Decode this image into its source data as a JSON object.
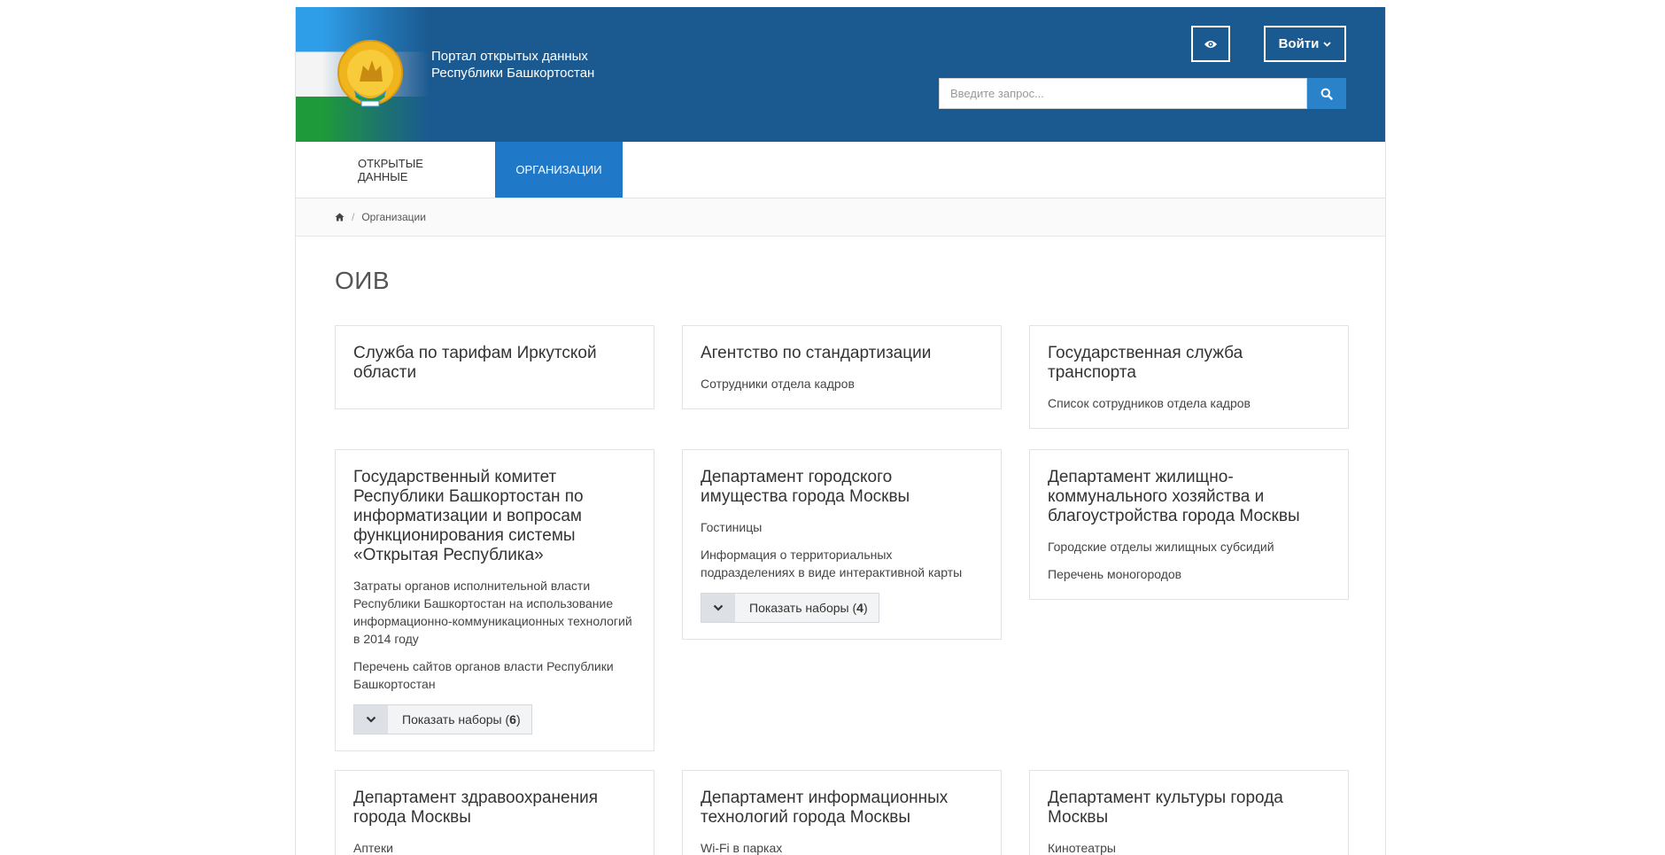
{
  "header": {
    "title_line1": "Портал открытых данных",
    "title_line2": "Республики Башкортостан",
    "login_label": "Войти",
    "search_placeholder": "Введите запрос..."
  },
  "nav": {
    "items": [
      {
        "label": "Открытые данные"
      },
      {
        "label": "Организации"
      }
    ]
  },
  "breadcrumb": {
    "current": "Организации"
  },
  "page": {
    "title": "ОИВ"
  },
  "cards": [
    {
      "title": "Служба по тарифам Иркутской области",
      "links": []
    },
    {
      "title": "Агентство по стандартизации",
      "links": [
        "Сотрудники отдела кадров"
      ]
    },
    {
      "title": "Государственная служба транспорта",
      "links": [
        "Список сотрудников отдела кадров"
      ]
    },
    {
      "title": "Государственный комитет Республики Башкортостан по информатизации и вопросам функционирования системы «Открытая Республика»",
      "links": [
        "Затраты органов исполнительной власти Республики Башкортостан на использование информационно-коммуникационных технологий в 2014 году",
        "Перечень сайтов органов власти Республики Башкортостан"
      ],
      "more_label": "Показать наборы (",
      "more_count": "6",
      "more_close": ")"
    },
    {
      "title": "Департамент городского имущества города Москвы",
      "links": [
        "Гостиницы",
        "Информация о территориальных подразделениях в виде интерактивной карты"
      ],
      "more_label": "Показать наборы (",
      "more_count": "4",
      "more_close": ")"
    },
    {
      "title": "Департамент жилищно-коммунального хозяйства и благоустройства города Москвы",
      "links": [
        "Городские отделы жилищных субсидий",
        "Перечень моногородов"
      ]
    },
    {
      "title": "Департамент здравоохранения города Москвы",
      "links": [
        "Аптеки"
      ]
    },
    {
      "title": "Департамент информационных технологий города Москвы",
      "links": [
        "Wi-Fi в парках"
      ]
    },
    {
      "title": "Департамент культуры города Москвы",
      "links": [
        "Кинотеатры"
      ]
    }
  ],
  "colors": {
    "header_bg": "#1b5a91",
    "nav_active_bg": "#1f78c8",
    "search_button_bg": "#2a83c9"
  },
  "icons": {
    "eye": "eye-icon",
    "login_chevron": "chevron-down-icon",
    "search": "search-icon",
    "home": "home-icon",
    "show_more_chevron": "chevron-down-icon"
  }
}
